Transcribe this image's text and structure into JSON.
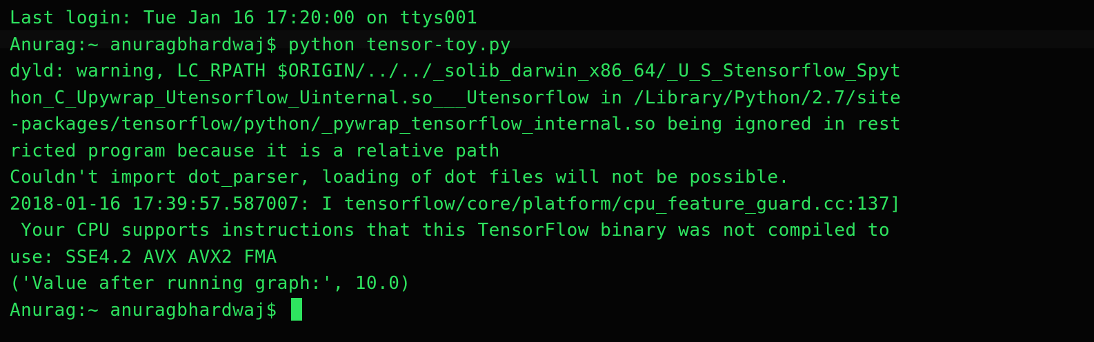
{
  "terminal": {
    "text_color": "#2ee35f",
    "background_color": "#050505",
    "lines": [
      "Last login: Tue Jan 16 17:20:00 on ttys001",
      "Anurag:~ anuragbhardwaj$ python tensor-toy.py",
      "dyld: warning, LC_RPATH $ORIGIN/../../_solib_darwin_x86_64/_U_S_Stensorflow_Spyt",
      "hon_C_Upywrap_Utensorflow_Uinternal.so___Utensorflow in /Library/Python/2.7/site",
      "-packages/tensorflow/python/_pywrap_tensorflow_internal.so being ignored in rest",
      "ricted program because it is a relative path",
      "Couldn't import dot_parser, loading of dot files will not be possible.",
      "2018-01-16 17:39:57.587007: I tensorflow/core/platform/cpu_feature_guard.cc:137]",
      " Your CPU supports instructions that this TensorFlow binary was not compiled to",
      "use: SSE4.2 AVX AVX2 FMA",
      "('Value after running graph:', 10.0)"
    ],
    "prompt": "Anurag:~ anuragbhardwaj$ "
  }
}
